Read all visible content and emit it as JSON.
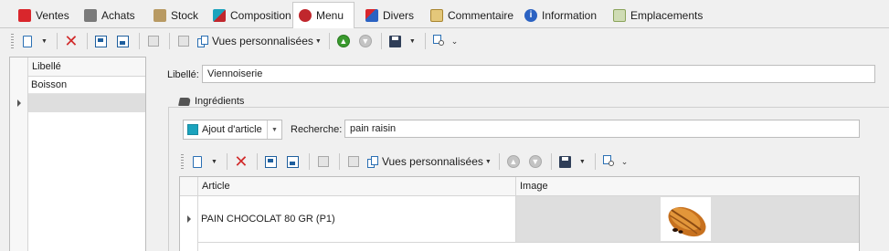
{
  "tabs": [
    {
      "label": "Ventes",
      "icon": "ventes-icon",
      "color": "#d9262c",
      "active": false
    },
    {
      "label": "Achats",
      "icon": "achats-icon",
      "color": "#7a7a7a",
      "active": false
    },
    {
      "label": "Stock",
      "icon": "stock-icon",
      "color": "#b89a63",
      "active": false
    },
    {
      "label": "Composition",
      "icon": "composition-icon",
      "color": "#1ba3bd",
      "active": false
    },
    {
      "label": "Menu",
      "icon": "menu-icon",
      "color": "#c0272d",
      "active": true
    },
    {
      "label": "Divers",
      "icon": "divers-icon",
      "color": "#2b62c2",
      "active": false
    },
    {
      "label": "Commentaire",
      "icon": "commentaire-icon",
      "color": "#c9a24d",
      "active": false
    },
    {
      "label": "Information",
      "icon": "information-icon",
      "color": "#2b62c2",
      "active": false
    },
    {
      "label": "Emplacements",
      "icon": "emplacements-icon",
      "color": "#8aa35a",
      "active": false
    }
  ],
  "toolbar_main": {
    "views_label": "Vues personnalisées"
  },
  "left_grid": {
    "column_header": "Libellé",
    "rows": [
      "Boisson",
      ""
    ]
  },
  "form": {
    "libelle_label": "Libellé:",
    "libelle_value": "Viennoiserie"
  },
  "ingredients": {
    "group_title": "Ingrédients",
    "add_article_label": "Ajout d'article",
    "search_label": "Recherche:",
    "search_value": "pain raisin",
    "toolbar_views_label": "Vues personnalisées",
    "columns": [
      "Article",
      "Image"
    ],
    "rows": [
      {
        "article": "PAIN CHOCOLAT 80 GR (P1)",
        "image": "pain-au-chocolat-image"
      }
    ]
  }
}
